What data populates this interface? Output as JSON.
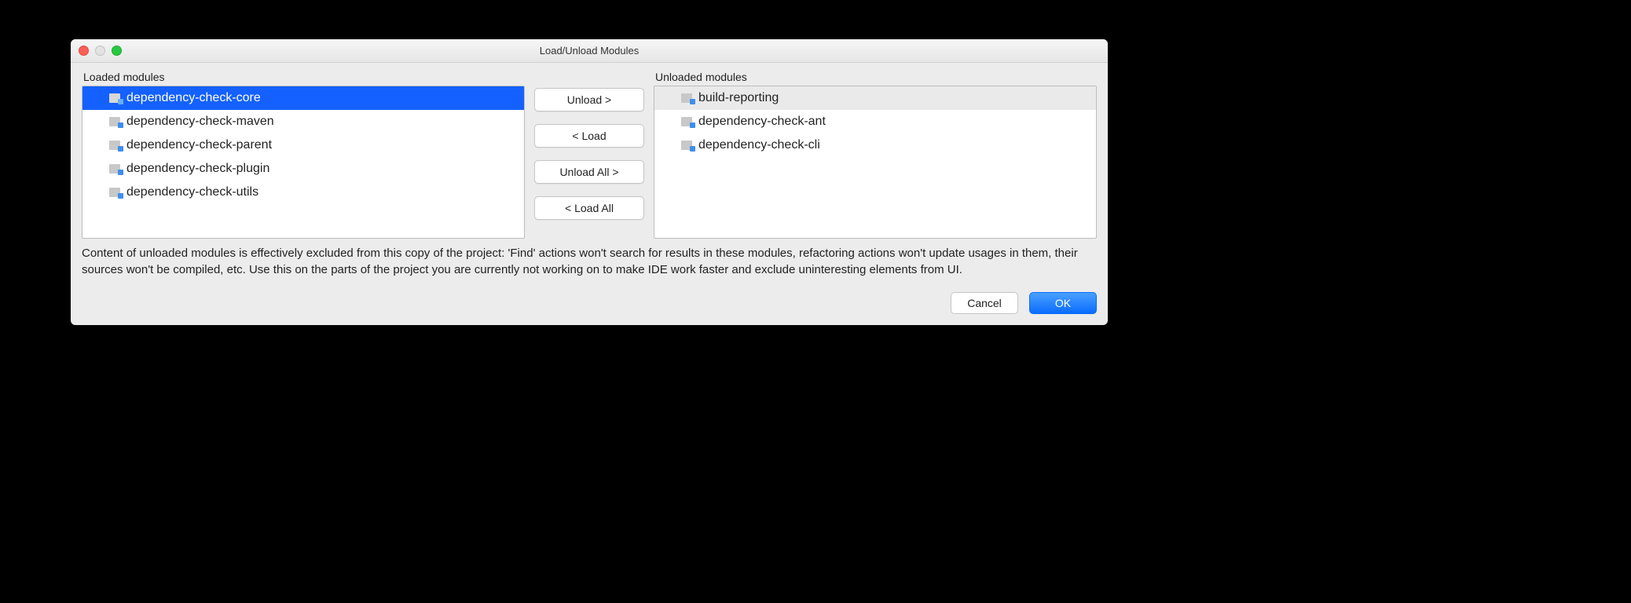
{
  "window": {
    "title": "Load/Unload Modules"
  },
  "labels": {
    "loaded": "Loaded modules",
    "unloaded": "Unloaded modules"
  },
  "loaded_modules": [
    {
      "name": "dependency-check-core",
      "selected": true
    },
    {
      "name": "dependency-check-maven",
      "selected": false
    },
    {
      "name": "dependency-check-parent",
      "selected": false
    },
    {
      "name": "dependency-check-plugin",
      "selected": false
    },
    {
      "name": "dependency-check-utils",
      "selected": false
    }
  ],
  "unloaded_modules": [
    {
      "name": "build-reporting",
      "alt": true
    },
    {
      "name": "dependency-check-ant",
      "alt": false
    },
    {
      "name": "dependency-check-cli",
      "alt": false
    }
  ],
  "buttons": {
    "unload": "Unload >",
    "load": "< Load",
    "unload_all": "Unload All >",
    "load_all": "< Load All",
    "cancel": "Cancel",
    "ok": "OK"
  },
  "note": "Content of unloaded modules is effectively excluded from this copy of the project: 'Find' actions won't search for results in these modules, refactoring actions won't update usages in them, their sources won't be compiled, etc. Use this on the parts of the project you are currently not working on to make IDE work faster and exclude uninteresting elements from UI."
}
